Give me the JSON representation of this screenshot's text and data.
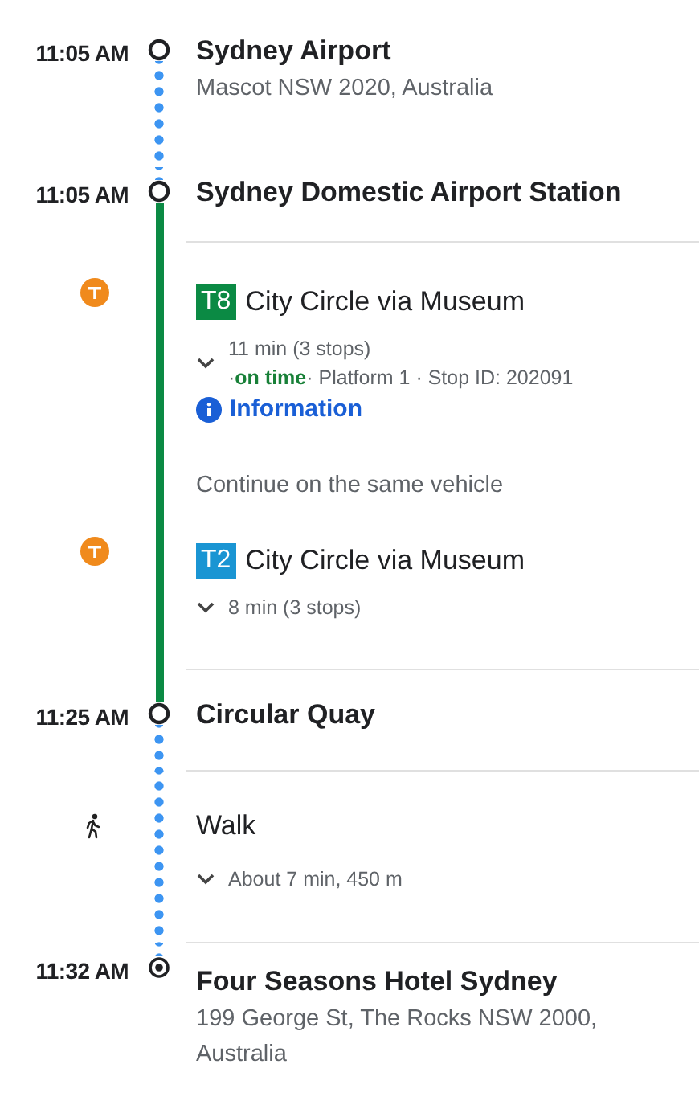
{
  "itinerary": [
    {
      "kind": "stop",
      "time": "11:05 AM",
      "destination": false,
      "title": "Sydney Airport",
      "address": "Mascot NSW 2020, Australia",
      "divider": false
    },
    {
      "kind": "stop",
      "time": "11:05 AM",
      "destination": false,
      "title": "Sydney Domestic Airport Station",
      "divider": true
    },
    {
      "kind": "transit",
      "route": "T8",
      "color": "#0b8a44",
      "title": "City Circle via Museum",
      "duration": "11 min (3 stops)",
      "status_line": [
        {
          "text": "·",
          "kind": "plain"
        },
        {
          "text": "on time",
          "kind": "ok"
        },
        {
          "text": "· Platform 1 · Stop ID: 202091",
          "kind": "plain"
        }
      ],
      "info_link": "Information",
      "divider": false
    },
    {
      "kind": "note",
      "text": "Continue on the same vehicle",
      "divider": false
    },
    {
      "kind": "transit",
      "route": "T2",
      "color": "#1a95d3",
      "title": "City Circle via Museum",
      "duration": "8 min (3 stops)",
      "divider": true
    },
    {
      "kind": "stop",
      "time": "11:25 AM",
      "destination": false,
      "title": "Circular Quay",
      "divider": true
    },
    {
      "kind": "walk",
      "title": "Walk",
      "duration": "About 7 min, 450 m",
      "divider": true
    },
    {
      "kind": "stop",
      "time": "11:32 AM",
      "destination": true,
      "title": "Four Seasons Hotel Sydney",
      "address": "199 George St, The Rocks NSW 2000, Australia",
      "divider": false
    }
  ]
}
